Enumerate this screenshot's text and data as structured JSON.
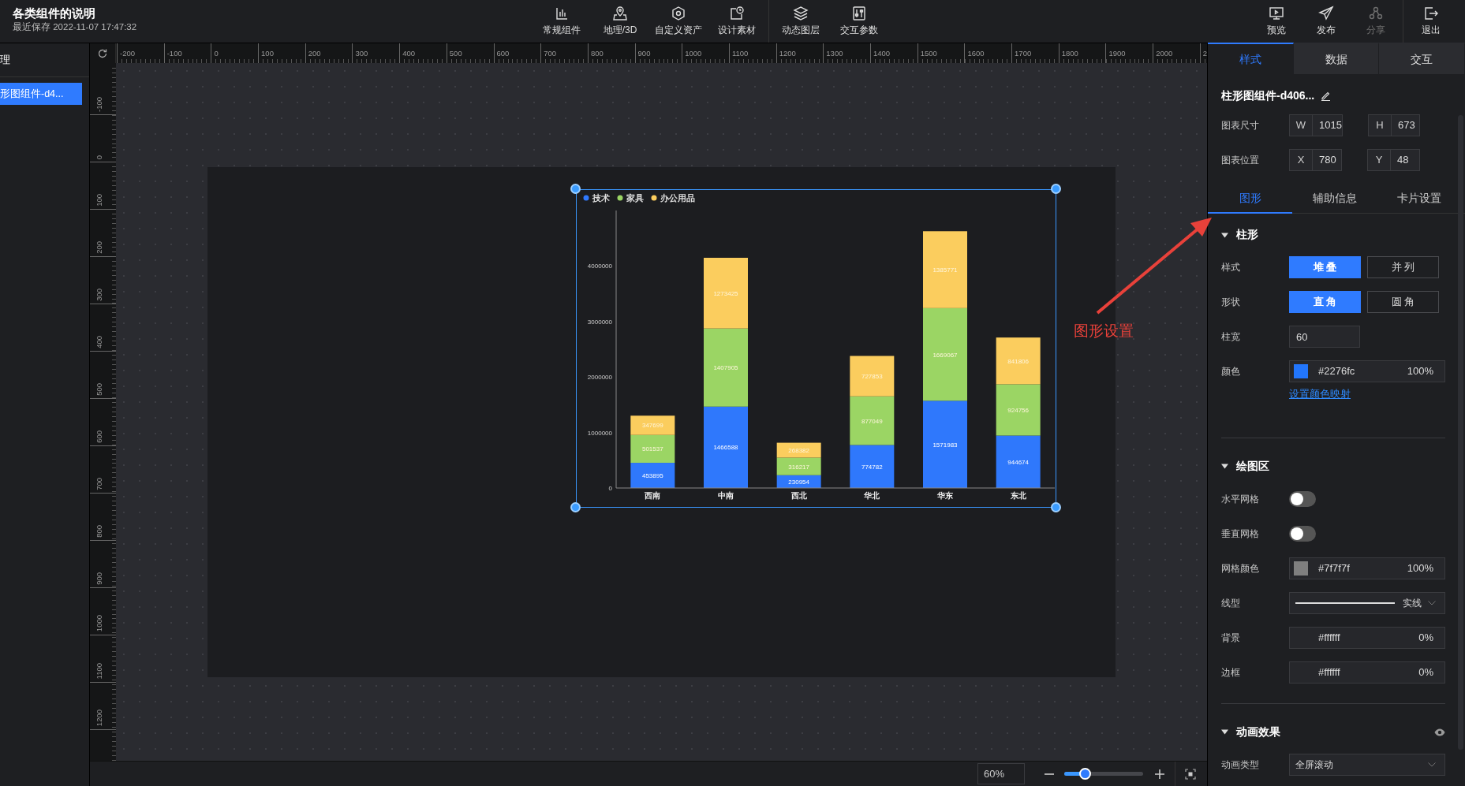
{
  "header": {
    "title": "各类组件的说明",
    "saved": "最近保存 2022-11-07 17:47:32"
  },
  "toolbar": {
    "groups": [
      [
        {
          "label": "常规组件"
        },
        {
          "label": "地理/3D"
        },
        {
          "label": "自定义资产"
        },
        {
          "label": "设计素材"
        }
      ],
      [
        {
          "label": "动态图层"
        },
        {
          "label": "交互参数"
        }
      ]
    ],
    "actions": [
      {
        "label": "预览",
        "disabled": false
      },
      {
        "label": "发布",
        "disabled": false
      },
      {
        "label": "分享",
        "disabled": true
      }
    ],
    "exit": {
      "label": "退出"
    }
  },
  "layers_panel": {
    "heading": "理",
    "items": [
      {
        "label": "形图组件-d4...",
        "selected": true
      }
    ]
  },
  "rulers": {
    "horizontal": [
      "-200",
      "-100",
      "0",
      "100",
      "200",
      "300",
      "400",
      "500",
      "600",
      "700",
      "800",
      "900",
      "1000",
      "1100",
      "1200",
      "1300",
      "1400",
      "1500",
      "1600",
      "1700",
      "1800",
      "1900",
      "2000",
      "2"
    ],
    "vertical": [
      "-100",
      "0",
      "100",
      "200",
      "300",
      "400",
      "500",
      "600",
      "700",
      "800",
      "900",
      "1000",
      "1100",
      "1200"
    ]
  },
  "chart": {
    "chart_data": {
      "type": "bar",
      "stacked": true,
      "categories": [
        "西南",
        "中南",
        "西北",
        "华北",
        "华东",
        "东北"
      ],
      "series": [
        {
          "name": "技术",
          "color": "#2f78fc",
          "values": [
            453895,
            1466588,
            230954,
            774782,
            1571983,
            944674
          ]
        },
        {
          "name": "家具",
          "color": "#9bd564",
          "values": [
            501537,
            1407905,
            316217,
            877049,
            1669067,
            924756
          ]
        },
        {
          "name": "办公用品",
          "color": "#fbcd5e",
          "values": [
            347699,
            1273425,
            268382,
            727853,
            1385771,
            841806
          ]
        }
      ],
      "yticks": [
        0,
        1000000,
        2000000,
        3000000,
        4000000
      ],
      "ylim": [
        0,
        5000000
      ],
      "legend": true,
      "data_labels": true
    }
  },
  "annotation": {
    "text": "图形设置"
  },
  "zoom_bar": {
    "value": "60%",
    "level": 0.26
  },
  "inspector": {
    "tabs": [
      {
        "label": "样式",
        "selected": true
      },
      {
        "label": "数据",
        "selected": false
      },
      {
        "label": "交互",
        "selected": false
      }
    ],
    "component_name": "柱形图组件-d406...",
    "geometry": [
      {
        "label": "图表尺寸",
        "fields": [
          {
            "prefix": "W",
            "value": "1015"
          },
          {
            "prefix": "H",
            "value": "673"
          }
        ]
      },
      {
        "label": "图表位置",
        "fields": [
          {
            "prefix": "X",
            "value": "780"
          },
          {
            "prefix": "Y",
            "value": "48"
          }
        ]
      }
    ],
    "subtabs": [
      {
        "label": "图形",
        "selected": true
      },
      {
        "label": "辅助信息",
        "selected": false
      },
      {
        "label": "卡片设置",
        "selected": false
      }
    ],
    "sections": [
      {
        "title": "柱形",
        "expanded": true,
        "rows": [
          {
            "kind": "segmented",
            "label": "样式",
            "options": [
              {
                "label": "堆 叠",
                "selected": true
              },
              {
                "label": "并 列",
                "selected": false
              }
            ]
          },
          {
            "kind": "segmented",
            "label": "形状",
            "options": [
              {
                "label": "直 角",
                "selected": true
              },
              {
                "label": "圆 角",
                "selected": false
              }
            ]
          },
          {
            "kind": "input",
            "label": "柱宽",
            "value": "60"
          },
          {
            "kind": "color",
            "label": "颜色",
            "color": "#2276fc",
            "value": "#2276fc",
            "opacity": "100%"
          },
          {
            "kind": "link",
            "text": "设置颜色映射"
          }
        ]
      },
      {
        "title": "绘图区",
        "expanded": true,
        "rows": [
          {
            "kind": "toggle",
            "label": "水平网格",
            "on": false
          },
          {
            "kind": "toggle",
            "label": "垂直网格",
            "on": false
          },
          {
            "kind": "color",
            "label": "网格颜色",
            "color": "#7f7f7f",
            "value": "#7f7f7f",
            "opacity": "100%"
          },
          {
            "kind": "line_select",
            "label": "线型",
            "value": "实线"
          },
          {
            "kind": "color",
            "label": "背景",
            "value": "#ffffff",
            "opacity": "0%"
          },
          {
            "kind": "color",
            "label": "边框",
            "value": "#ffffff",
            "opacity": "0%"
          }
        ]
      },
      {
        "title": "动画效果",
        "expanded": true,
        "visible": true,
        "rows": [
          {
            "kind": "select",
            "label": "动画类型",
            "value": "全屏滚动"
          }
        ]
      }
    ]
  }
}
